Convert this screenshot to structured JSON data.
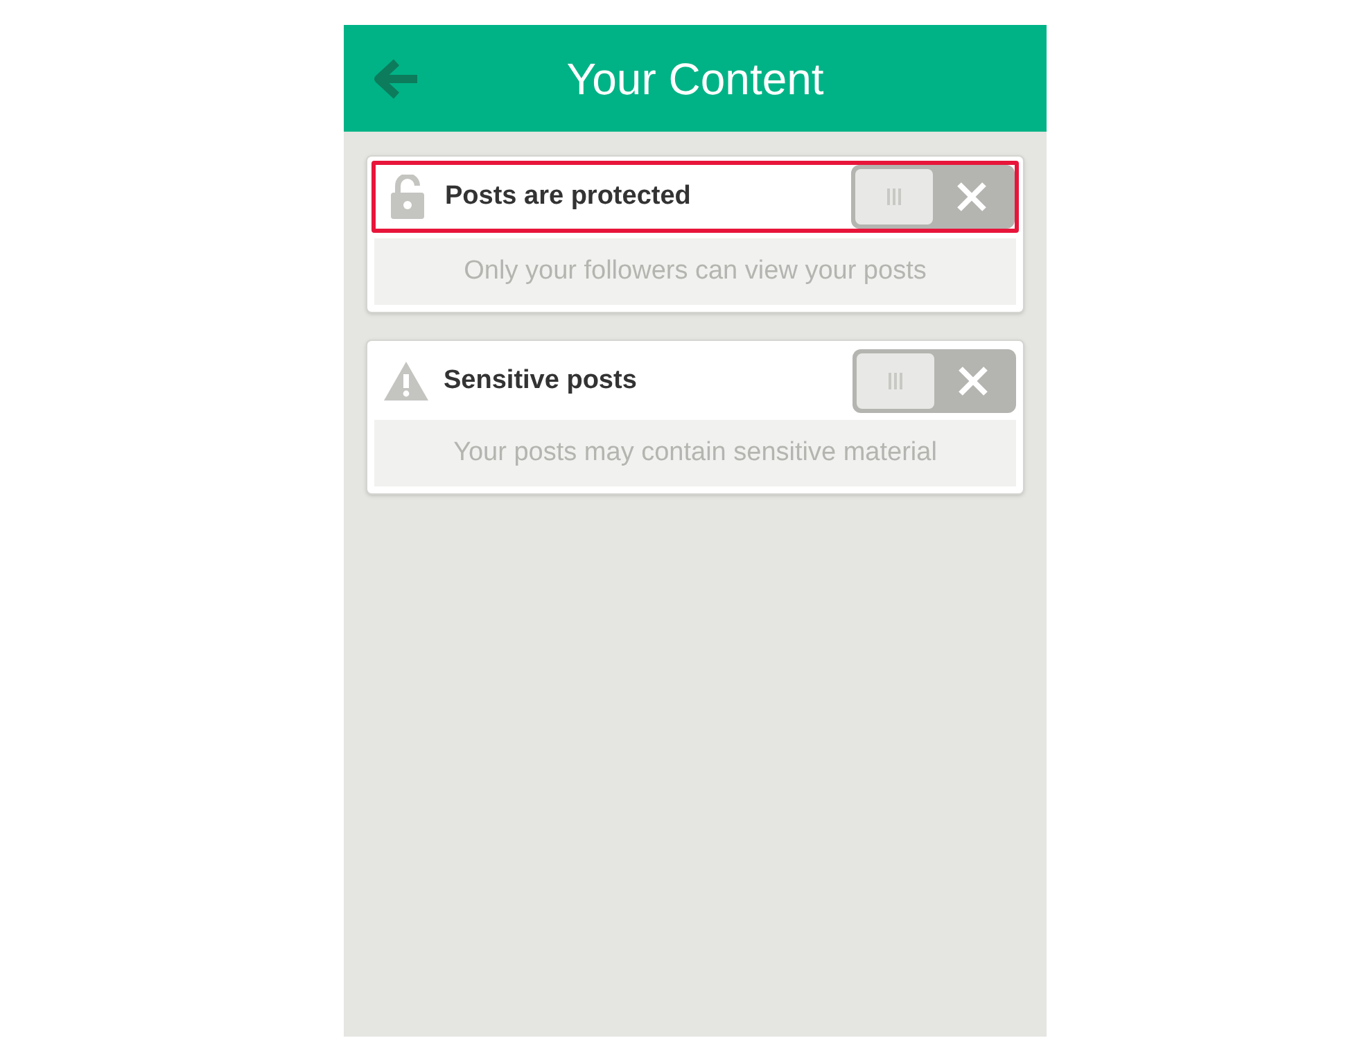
{
  "header": {
    "title": "Your Content"
  },
  "settings": [
    {
      "kind": "lock",
      "label": "Posts are protected",
      "on": false,
      "highlighted": true,
      "description": "Only your followers can view your posts"
    },
    {
      "kind": "warning",
      "label": "Sensitive posts",
      "on": false,
      "highlighted": false,
      "description": "Your posts may contain sensitive material"
    }
  ]
}
